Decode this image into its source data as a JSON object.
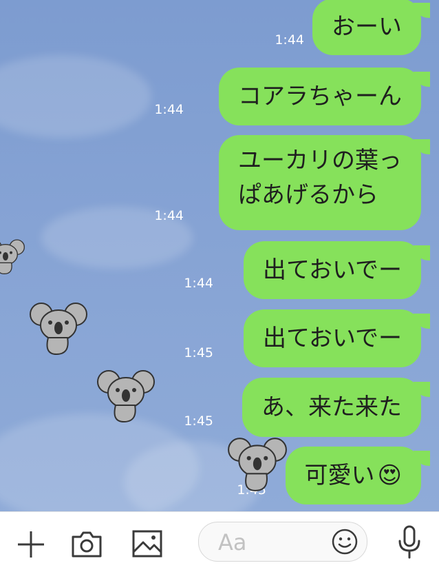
{
  "messages": [
    {
      "text": "おーい",
      "time": "1:44"
    },
    {
      "text": "コアラちゃーん",
      "time": "1:44"
    },
    {
      "line1": "ユーカリの葉っ",
      "line2": "ぱあげるから",
      "time": "1:44"
    },
    {
      "text": "出ておいでー",
      "time": "1:44"
    },
    {
      "text": "出ておいでー",
      "time": "1:45"
    },
    {
      "text": "あ、来た来た",
      "time": "1:45"
    },
    {
      "text": "可愛い",
      "emoji": "😍",
      "time": "1:45"
    }
  ],
  "toolbar": {
    "input_placeholder": "Aa",
    "icons": [
      "plus-icon",
      "camera-icon",
      "image-icon",
      "smile-icon",
      "microphone-icon"
    ]
  },
  "colors": {
    "bubble": "#86e15b",
    "chat_background": "#7d9cd0",
    "toolbar_icon": "#3a3a3a"
  }
}
